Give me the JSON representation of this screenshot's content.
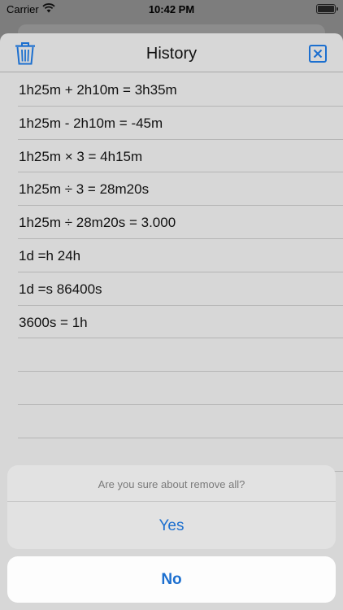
{
  "status_bar": {
    "carrier": "Carrier",
    "time": "10:42 PM"
  },
  "header": {
    "title": "History",
    "delete_icon": "trash-icon",
    "close_icon": "close-x-box-icon"
  },
  "history": [
    "1h25m + 2h10m = 3h35m",
    "1h25m - 2h10m = -45m",
    "1h25m × 3 = 4h15m",
    "1h25m ÷ 3 = 28m20s",
    "1h25m ÷ 28m20s = 3.000",
    "1d =h 24h",
    "1d =s 86400s",
    "3600s = 1h",
    "",
    "",
    "",
    ""
  ],
  "action_sheet": {
    "message": "Are you sure about remove all?",
    "confirm_label": "Yes",
    "cancel_label": "No"
  },
  "colors": {
    "accent": "#1C6FCF"
  }
}
